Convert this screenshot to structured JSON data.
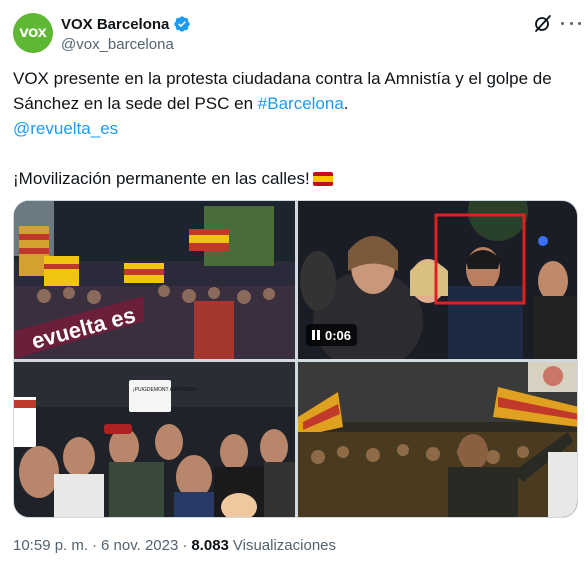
{
  "author": {
    "display_name": "VOX Barcelona",
    "handle": "@vox_barcelona",
    "avatar_text": "VOX",
    "verified": true
  },
  "tweet": {
    "line1_text": "VOX presente en la protesta ciudadana contra la Amnistía y el golpe de Sánchez en la sede del PSC en ",
    "hashtag": "#Barcelona",
    "line1_end": ".",
    "mention": "@revuelta_es",
    "line2_text": "¡Movilización permanente en las calles!",
    "flag_icon": "spain-flag-emoji"
  },
  "media": {
    "video_duration": "0:06",
    "sign_text": "¡PUIGDEMONT A PRISIÓN!",
    "banner_text": "evuelta es"
  },
  "footer": {
    "time": "10:59 p. m.",
    "separator": "·",
    "date": "6 nov. 2023",
    "views_count": "8.083",
    "views_label": "Visualizaciones"
  },
  "colors": {
    "brand_green": "#5fb834",
    "link_blue": "#1d9bf0",
    "muted_text": "#536471"
  }
}
